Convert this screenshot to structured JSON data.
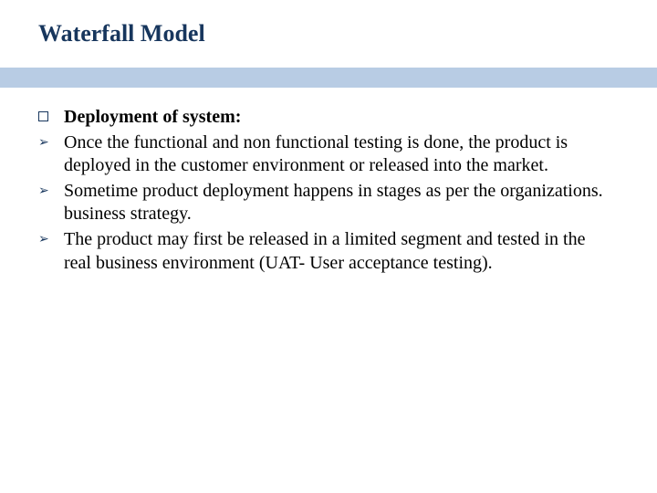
{
  "title": "Waterfall Model",
  "heading": "Deployment of system:",
  "bullets": [
    "Once the functional and non functional testing is done, the product is deployed in the customer environment or released into the market.",
    " Sometime product deployment happens in stages as per the organizations. business strategy.",
    "The product may first be released in a limited segment and tested in the real business environment (UAT- User acceptance testing)."
  ]
}
